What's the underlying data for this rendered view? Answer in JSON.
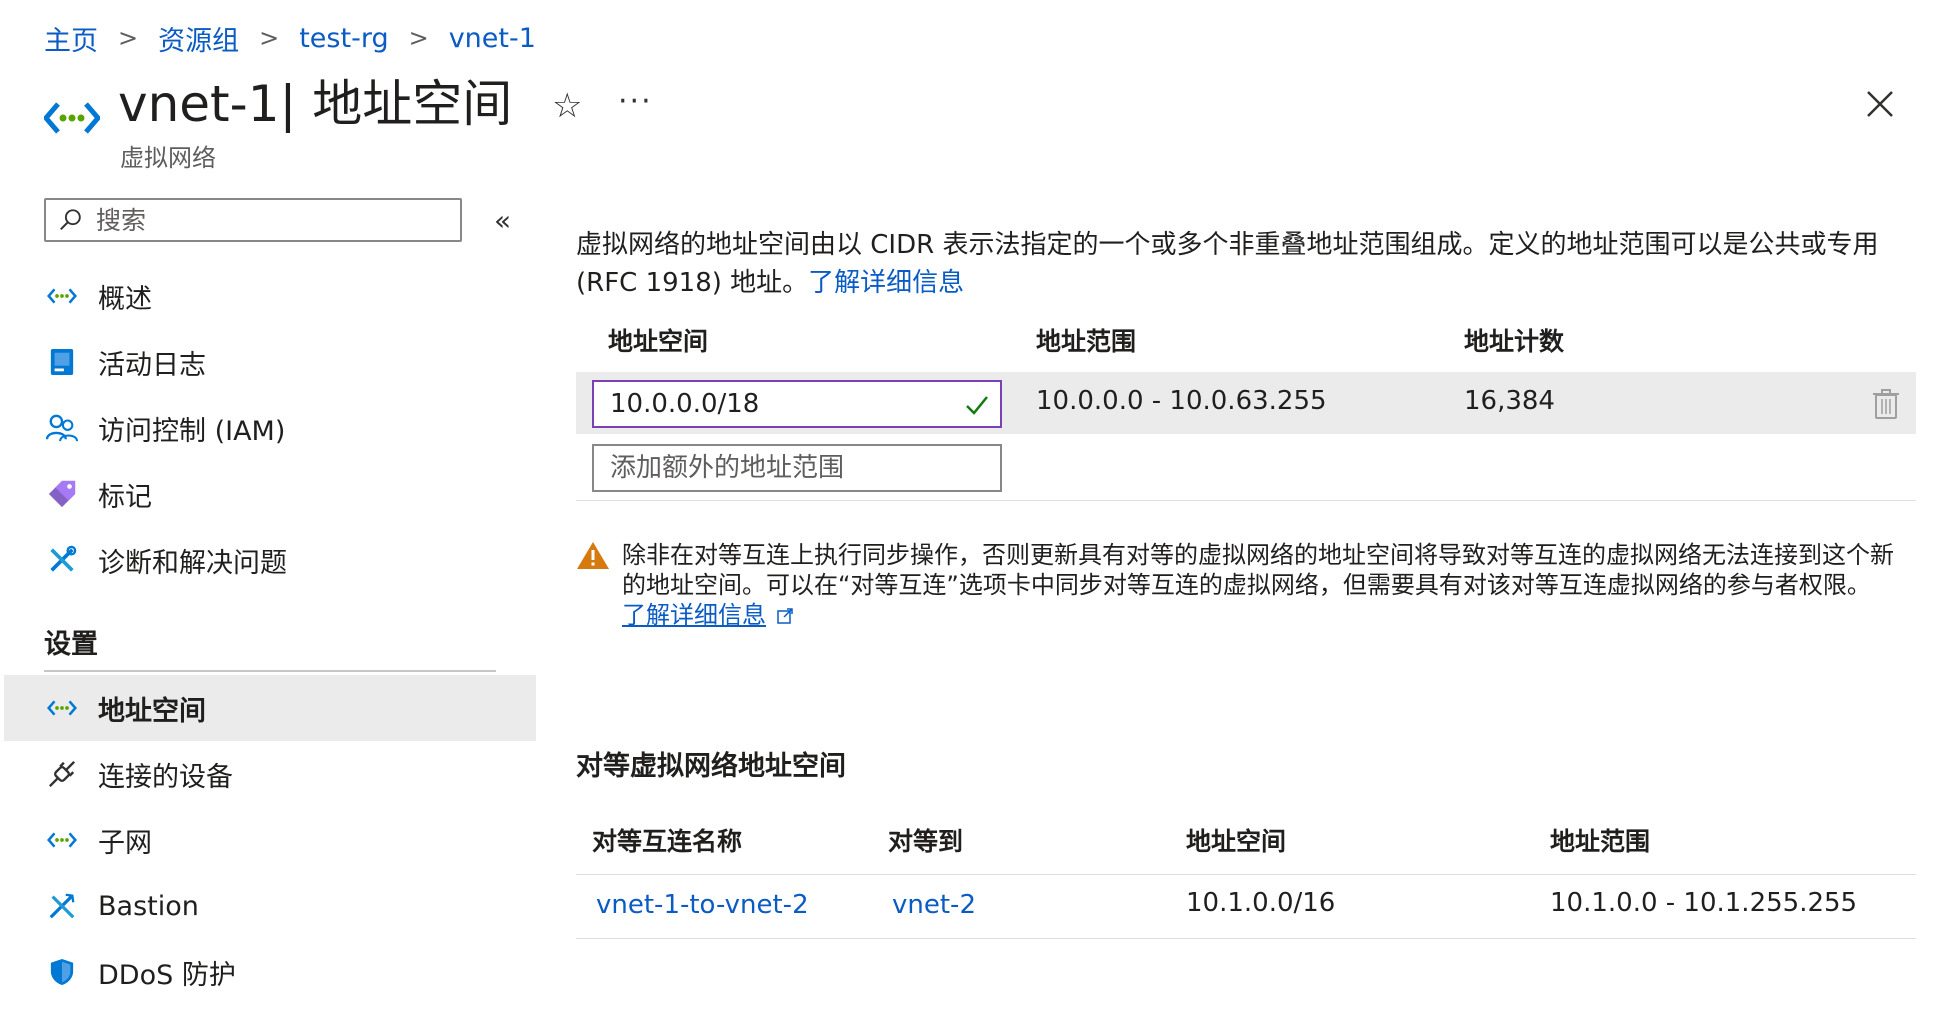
{
  "breadcrumb": {
    "home": "主页",
    "resource_groups": "资源组",
    "rg": "test-rg",
    "vnet": "vnet-1",
    "separator": ">"
  },
  "header": {
    "title": "vnet-1| 地址空间",
    "subtitle": "虚拟网络",
    "star_glyph": "☆",
    "more_glyph": "···"
  },
  "sidebar": {
    "search_placeholder": "搜索",
    "collapse_glyph": "«",
    "items": [
      {
        "label": "概述",
        "icon": "vnet-icon"
      },
      {
        "label": "活动日志",
        "icon": "activity-log-icon"
      },
      {
        "label": "访问控制 (IAM)",
        "icon": "iam-icon"
      },
      {
        "label": "标记",
        "icon": "tag-icon"
      },
      {
        "label": "诊断和解决问题",
        "icon": "wrench-icon"
      }
    ],
    "settings_heading": "设置",
    "settings_items": [
      {
        "label": "地址空间",
        "icon": "vnet-icon",
        "active": true
      },
      {
        "label": "连接的设备",
        "icon": "plug-icon"
      },
      {
        "label": "子网",
        "icon": "vnet-icon"
      },
      {
        "label": "Bastion",
        "icon": "bastion-icon"
      },
      {
        "label": "DDoS 防护",
        "icon": "shield-icon"
      }
    ]
  },
  "main": {
    "description": "虚拟网络的地址空间由以 CIDR 表示法指定的一个或多个非重叠地址范围组成。定义的地址范围可以是公共或专用 (RFC 1918) 地址。",
    "learn_more": "了解详细信息",
    "address_table": {
      "headers": [
        "地址空间",
        "地址范围",
        "地址计数"
      ],
      "rows": [
        {
          "address_space": "10.0.0.0/18",
          "address_range": "10.0.0.0 - 10.0.63.255",
          "address_count": "16,384"
        }
      ],
      "add_placeholder": "添加额外的地址范围"
    },
    "warning": {
      "text": "除非在对等互连上执行同步操作，否则更新具有对等的虚拟网络的地址空间将导致对等互连的虚拟网络无法连接到这个新的地址空间。可以在“对等互连”选项卡中同步对等互连的虚拟网络，但需要具有对该对等互连虚拟网络的参与者权限。",
      "link": "了解详细信息"
    },
    "peer_section": {
      "title": "对等虚拟网络地址空间",
      "headers": [
        "对等互连名称",
        "对等到",
        "地址空间",
        "地址范围"
      ],
      "rows": [
        {
          "name": "vnet-1-to-vnet-2",
          "peer": "vnet-2",
          "address_space": "10.1.0.0/16",
          "address_range": "10.1.0.0 - 10.1.255.255"
        }
      ]
    }
  },
  "colors": {
    "link": "#0a5bc4",
    "active_bg": "#ebebeb",
    "input_focus": "#7b3fb8",
    "success": "#107c10",
    "warning": "#d67a0f"
  }
}
